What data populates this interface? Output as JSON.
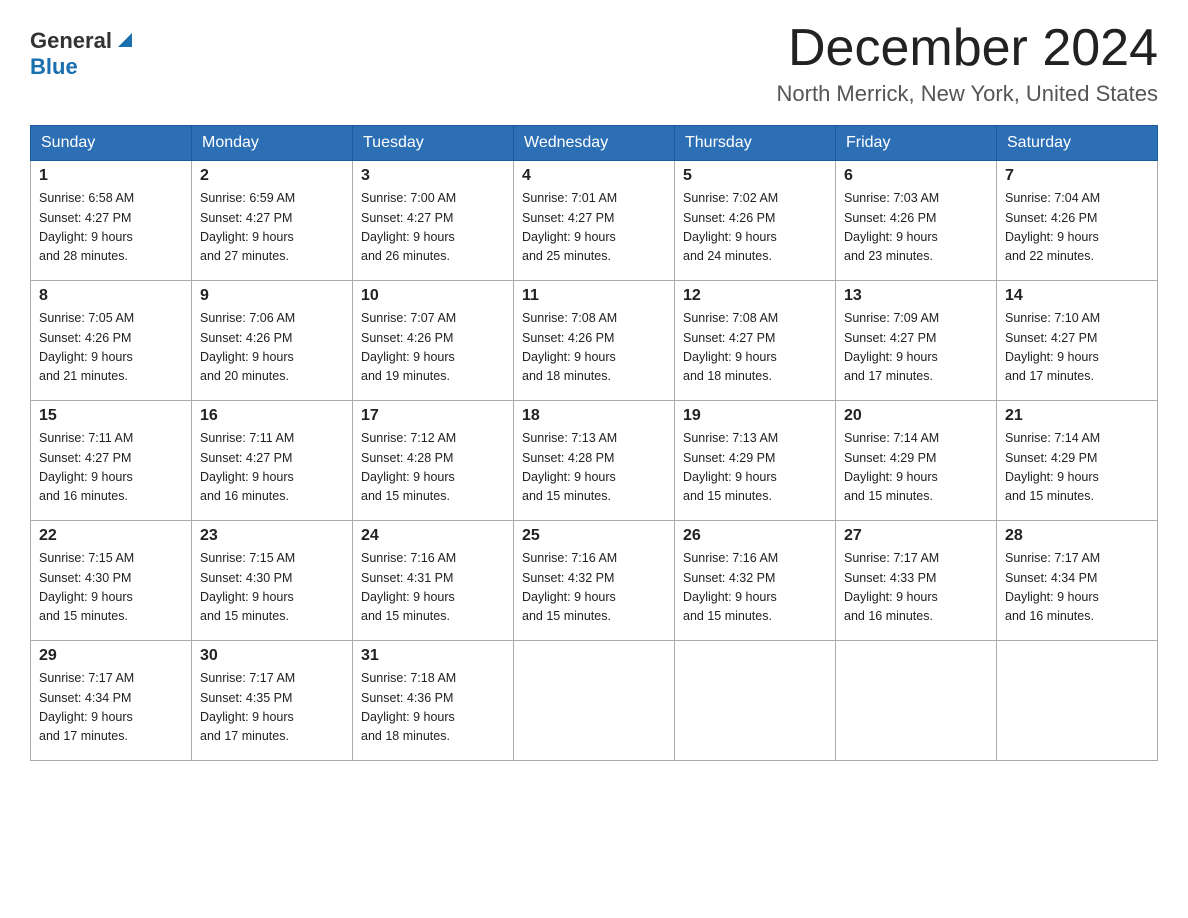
{
  "header": {
    "logo_general": "General",
    "logo_blue": "Blue",
    "month_title": "December 2024",
    "location": "North Merrick, New York, United States"
  },
  "days_of_week": [
    "Sunday",
    "Monday",
    "Tuesday",
    "Wednesday",
    "Thursday",
    "Friday",
    "Saturday"
  ],
  "weeks": [
    [
      {
        "day": "1",
        "sunrise": "6:58 AM",
        "sunset": "4:27 PM",
        "daylight": "9 hours and 28 minutes."
      },
      {
        "day": "2",
        "sunrise": "6:59 AM",
        "sunset": "4:27 PM",
        "daylight": "9 hours and 27 minutes."
      },
      {
        "day": "3",
        "sunrise": "7:00 AM",
        "sunset": "4:27 PM",
        "daylight": "9 hours and 26 minutes."
      },
      {
        "day": "4",
        "sunrise": "7:01 AM",
        "sunset": "4:27 PM",
        "daylight": "9 hours and 25 minutes."
      },
      {
        "day": "5",
        "sunrise": "7:02 AM",
        "sunset": "4:26 PM",
        "daylight": "9 hours and 24 minutes."
      },
      {
        "day": "6",
        "sunrise": "7:03 AM",
        "sunset": "4:26 PM",
        "daylight": "9 hours and 23 minutes."
      },
      {
        "day": "7",
        "sunrise": "7:04 AM",
        "sunset": "4:26 PM",
        "daylight": "9 hours and 22 minutes."
      }
    ],
    [
      {
        "day": "8",
        "sunrise": "7:05 AM",
        "sunset": "4:26 PM",
        "daylight": "9 hours and 21 minutes."
      },
      {
        "day": "9",
        "sunrise": "7:06 AM",
        "sunset": "4:26 PM",
        "daylight": "9 hours and 20 minutes."
      },
      {
        "day": "10",
        "sunrise": "7:07 AM",
        "sunset": "4:26 PM",
        "daylight": "9 hours and 19 minutes."
      },
      {
        "day": "11",
        "sunrise": "7:08 AM",
        "sunset": "4:26 PM",
        "daylight": "9 hours and 18 minutes."
      },
      {
        "day": "12",
        "sunrise": "7:08 AM",
        "sunset": "4:27 PM",
        "daylight": "9 hours and 18 minutes."
      },
      {
        "day": "13",
        "sunrise": "7:09 AM",
        "sunset": "4:27 PM",
        "daylight": "9 hours and 17 minutes."
      },
      {
        "day": "14",
        "sunrise": "7:10 AM",
        "sunset": "4:27 PM",
        "daylight": "9 hours and 17 minutes."
      }
    ],
    [
      {
        "day": "15",
        "sunrise": "7:11 AM",
        "sunset": "4:27 PM",
        "daylight": "9 hours and 16 minutes."
      },
      {
        "day": "16",
        "sunrise": "7:11 AM",
        "sunset": "4:27 PM",
        "daylight": "9 hours and 16 minutes."
      },
      {
        "day": "17",
        "sunrise": "7:12 AM",
        "sunset": "4:28 PM",
        "daylight": "9 hours and 15 minutes."
      },
      {
        "day": "18",
        "sunrise": "7:13 AM",
        "sunset": "4:28 PM",
        "daylight": "9 hours and 15 minutes."
      },
      {
        "day": "19",
        "sunrise": "7:13 AM",
        "sunset": "4:29 PM",
        "daylight": "9 hours and 15 minutes."
      },
      {
        "day": "20",
        "sunrise": "7:14 AM",
        "sunset": "4:29 PM",
        "daylight": "9 hours and 15 minutes."
      },
      {
        "day": "21",
        "sunrise": "7:14 AM",
        "sunset": "4:29 PM",
        "daylight": "9 hours and 15 minutes."
      }
    ],
    [
      {
        "day": "22",
        "sunrise": "7:15 AM",
        "sunset": "4:30 PM",
        "daylight": "9 hours and 15 minutes."
      },
      {
        "day": "23",
        "sunrise": "7:15 AM",
        "sunset": "4:30 PM",
        "daylight": "9 hours and 15 minutes."
      },
      {
        "day": "24",
        "sunrise": "7:16 AM",
        "sunset": "4:31 PM",
        "daylight": "9 hours and 15 minutes."
      },
      {
        "day": "25",
        "sunrise": "7:16 AM",
        "sunset": "4:32 PM",
        "daylight": "9 hours and 15 minutes."
      },
      {
        "day": "26",
        "sunrise": "7:16 AM",
        "sunset": "4:32 PM",
        "daylight": "9 hours and 15 minutes."
      },
      {
        "day": "27",
        "sunrise": "7:17 AM",
        "sunset": "4:33 PM",
        "daylight": "9 hours and 16 minutes."
      },
      {
        "day": "28",
        "sunrise": "7:17 AM",
        "sunset": "4:34 PM",
        "daylight": "9 hours and 16 minutes."
      }
    ],
    [
      {
        "day": "29",
        "sunrise": "7:17 AM",
        "sunset": "4:34 PM",
        "daylight": "9 hours and 17 minutes."
      },
      {
        "day": "30",
        "sunrise": "7:17 AM",
        "sunset": "4:35 PM",
        "daylight": "9 hours and 17 minutes."
      },
      {
        "day": "31",
        "sunrise": "7:18 AM",
        "sunset": "4:36 PM",
        "daylight": "9 hours and 18 minutes."
      },
      null,
      null,
      null,
      null
    ]
  ]
}
